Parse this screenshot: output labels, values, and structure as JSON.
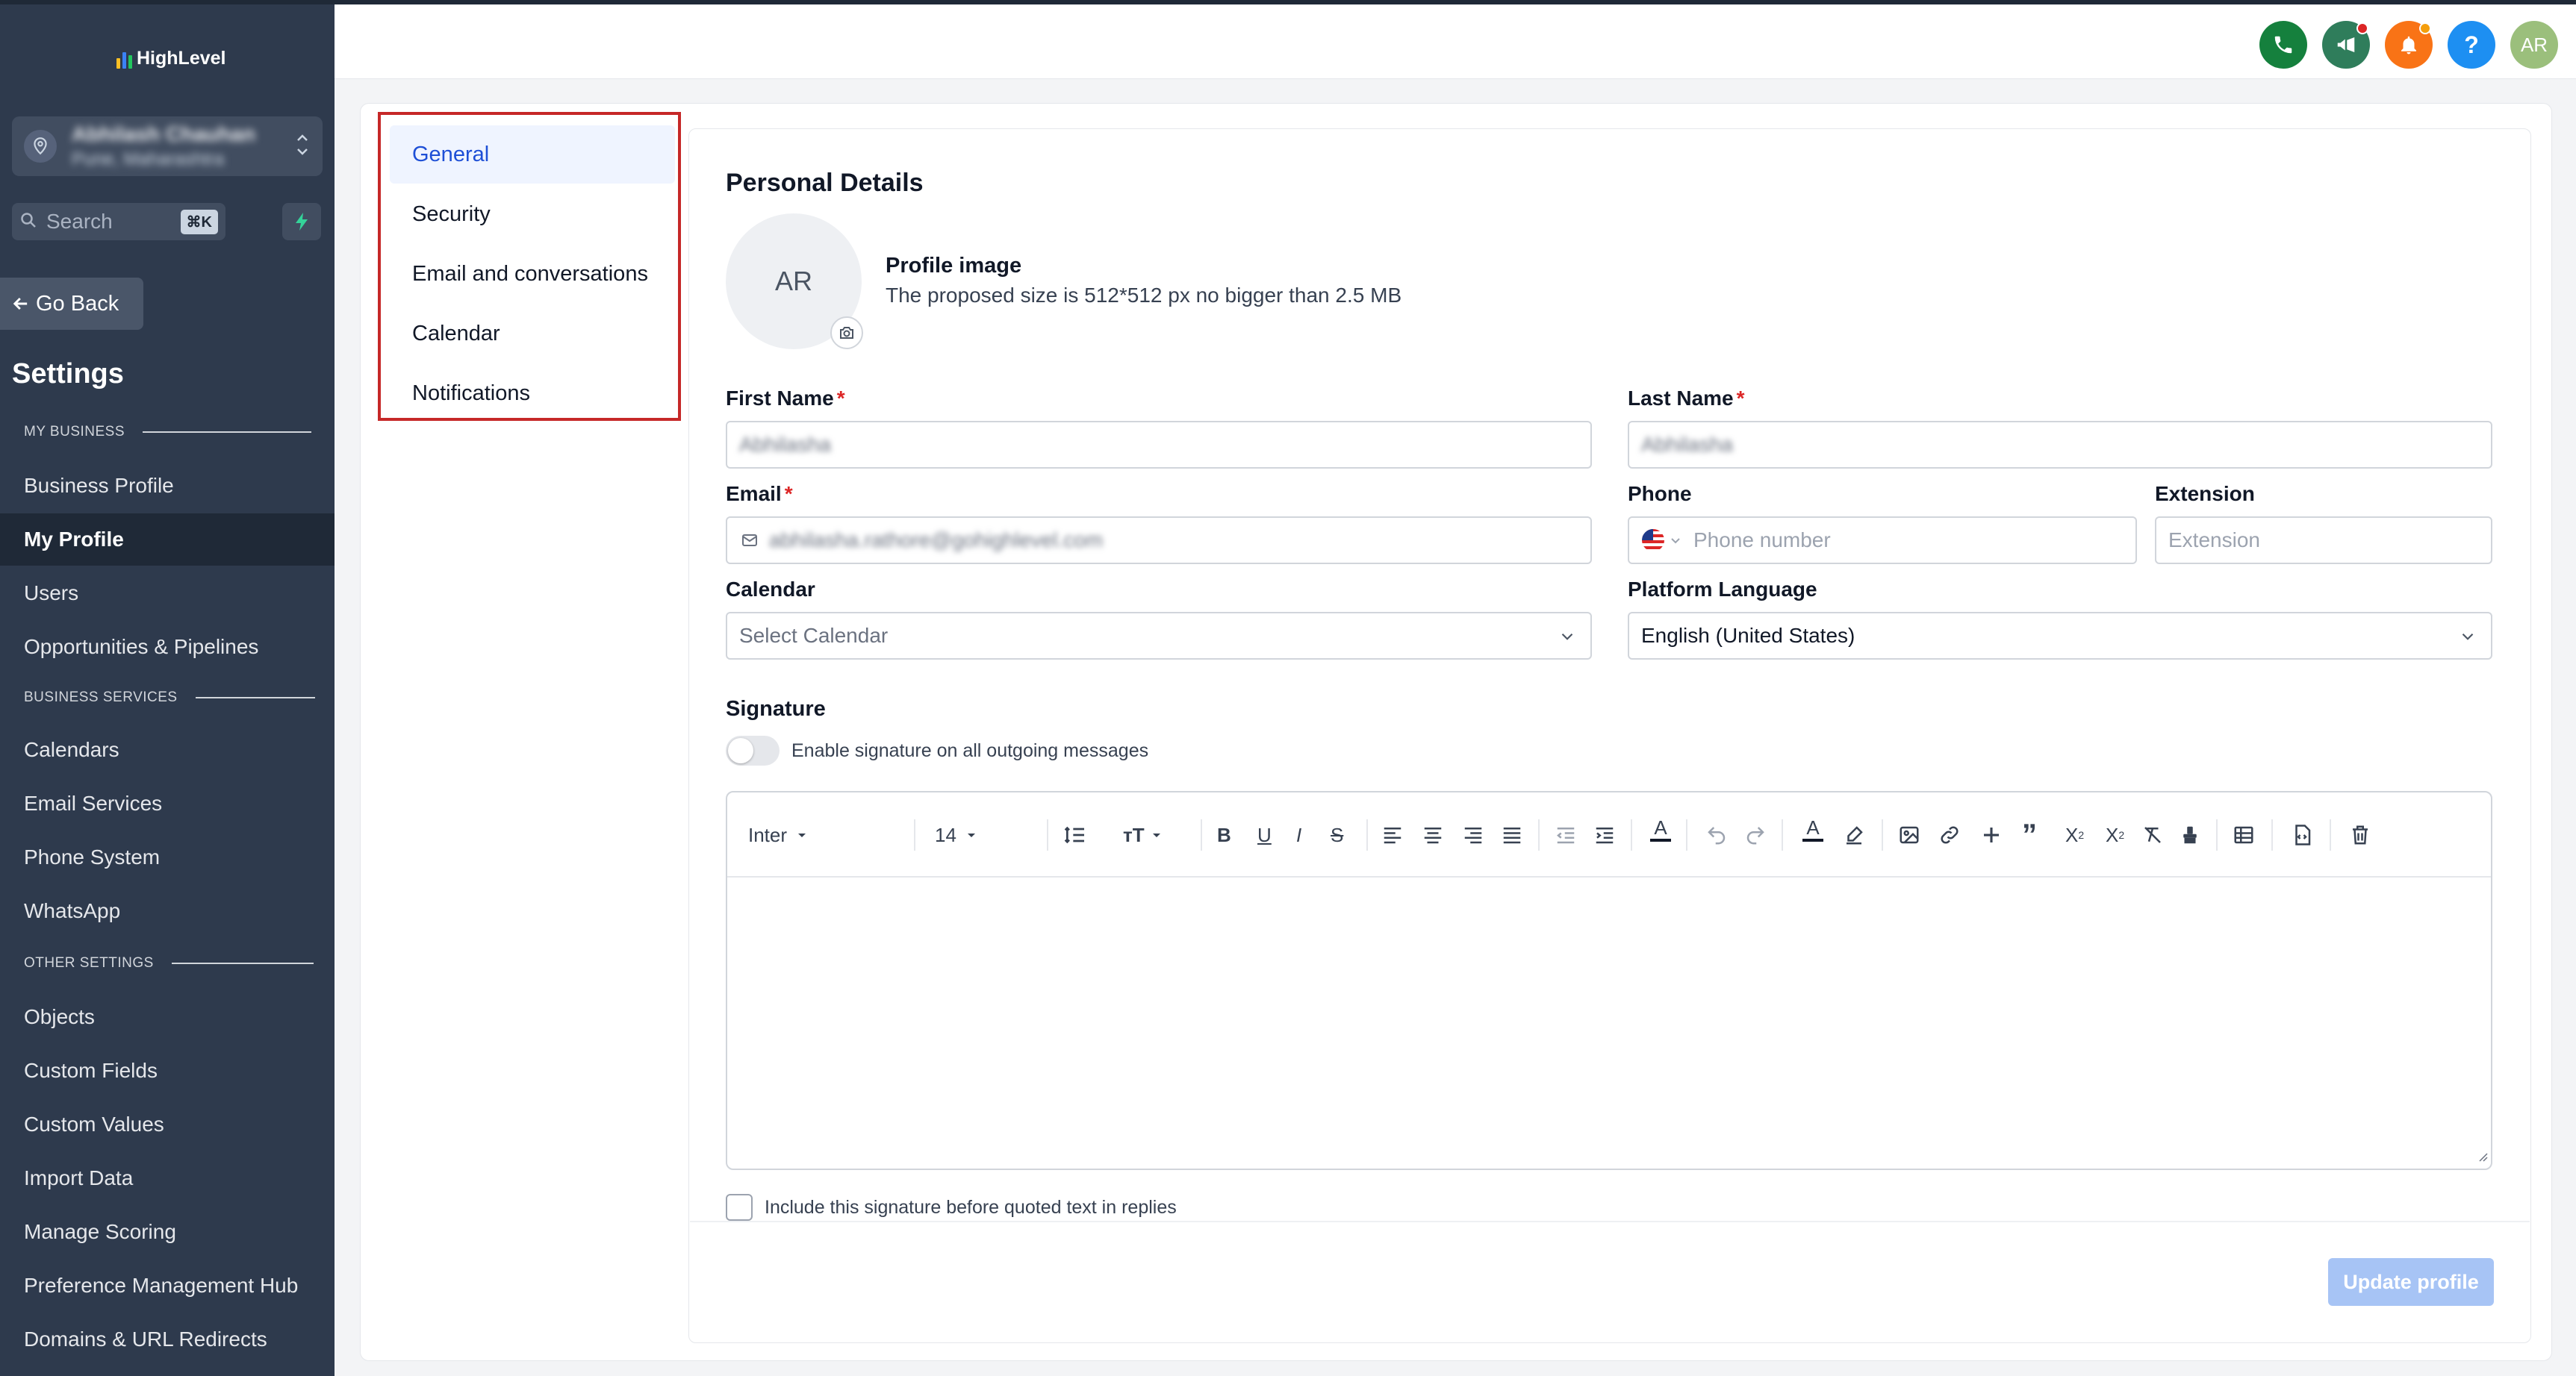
{
  "brand": {
    "name": "HighLevel"
  },
  "account": {
    "name": "Abhilash Chauhan",
    "location": "Pune, Maharashtra"
  },
  "search": {
    "placeholder": "Search",
    "shortcut": "⌘K"
  },
  "sidebar": {
    "go_back": "Go Back",
    "title": "Settings",
    "sections": [
      {
        "label": "MY BUSINESS"
      },
      {
        "label": "BUSINESS SERVICES"
      },
      {
        "label": "OTHER SETTINGS"
      }
    ],
    "items": [
      {
        "label": "Business Profile"
      },
      {
        "label": "My Profile",
        "active": true
      },
      {
        "label": "Users"
      },
      {
        "label": "Opportunities & Pipelines"
      },
      {
        "label": "Calendars"
      },
      {
        "label": "Email Services"
      },
      {
        "label": "Phone System"
      },
      {
        "label": "WhatsApp"
      },
      {
        "label": "Objects"
      },
      {
        "label": "Custom Fields"
      },
      {
        "label": "Custom Values"
      },
      {
        "label": "Import Data"
      },
      {
        "label": "Manage Scoring"
      },
      {
        "label": "Preference Management Hub"
      },
      {
        "label": "Domains & URL Redirects"
      }
    ]
  },
  "header": {
    "buttons": [
      {
        "icon": "phone-icon",
        "color": "#15803d"
      },
      {
        "icon": "megaphone-icon",
        "color": "#2f7d5b"
      },
      {
        "icon": "bell-icon",
        "color": "#f97316"
      },
      {
        "icon": "help-icon",
        "label": "?",
        "color": "#1d8ff2"
      },
      {
        "icon": "avatar",
        "label": "AR",
        "color": "#9bbf7c"
      }
    ]
  },
  "subnav": {
    "items": [
      {
        "label": "General",
        "active": true
      },
      {
        "label": "Security"
      },
      {
        "label": "Email and conversations"
      },
      {
        "label": "Calendar"
      },
      {
        "label": "Notifications"
      }
    ]
  },
  "profile": {
    "section_title": "Personal Details",
    "initials": "AR",
    "image_title": "Profile image",
    "image_desc": "The proposed size is 512*512 px no bigger than 2.5 MB"
  },
  "form": {
    "first_name": {
      "label": "First Name",
      "required": "*",
      "value": "Abhilasha"
    },
    "last_name": {
      "label": "Last Name",
      "required": "*",
      "value": "Abhilasha"
    },
    "email": {
      "label": "Email",
      "required": "*",
      "value": "abhilasha.rathore@gohighlevel.com"
    },
    "phone": {
      "label": "Phone",
      "placeholder": "Phone number"
    },
    "extension": {
      "label": "Extension",
      "placeholder": "Extension"
    },
    "calendar": {
      "label": "Calendar",
      "placeholder": "Select Calendar"
    },
    "language": {
      "label": "Platform Language",
      "value": "English (United States)"
    }
  },
  "signature": {
    "label": "Signature",
    "toggle_label": "Enable signature on all outgoing messages",
    "toggle_on": false,
    "font": "Inter",
    "size": "14",
    "include_label": "Include this signature before quoted text in replies",
    "include_checked": false
  },
  "actions": {
    "update": "Update profile"
  },
  "colors": {
    "accent": "#1e4fd6",
    "sidebar": "#2e3a4d",
    "highlight_border": "#c62828"
  }
}
